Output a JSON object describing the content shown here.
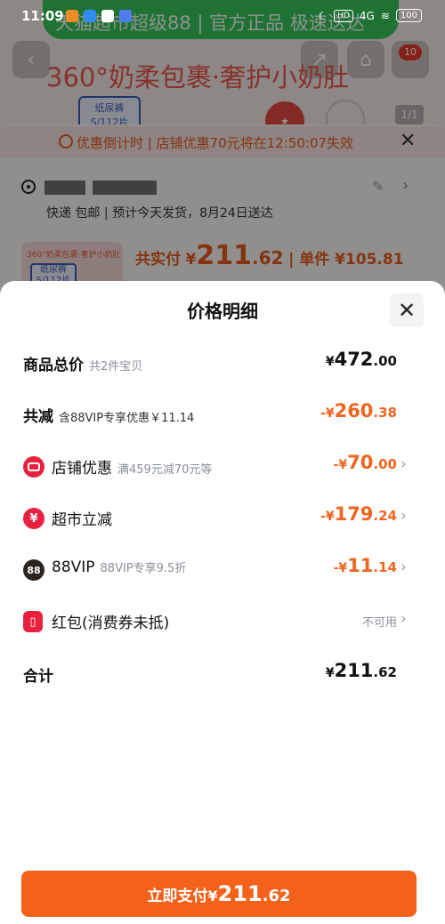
{
  "status_bar": {
    "time": "11:09",
    "network": "4G",
    "hd": "HD",
    "battery": "100"
  },
  "background": {
    "banner": "天猫超市超级88 | 官方正品 极速送达",
    "product_title": "360°奶柔包裹·奢护小奶肚",
    "pack_label": "纸尿裤 S/112片",
    "counter": "1/1",
    "cart_badge": "10",
    "countdown": "优惠倒计时 | 店铺优惠70元将在12:50:07失效",
    "shipping": "快递 包邮 | 预计今天发货，8月24日送达",
    "thumb_caption": "360°奶柔包裹·奢护小奶肚",
    "thumb_pack": "纸尿裤 S/112片",
    "total_label": "共实付",
    "total_currency": "¥",
    "total_int": "211",
    "total_dec": ".62",
    "unit_label": "| 单件 ¥105.81"
  },
  "sheet": {
    "title": "价格明细",
    "rows": {
      "goods_total": {
        "label": "商品总价",
        "note": "共2件宝贝",
        "cur": "¥",
        "int": "472",
        "dec": ".00"
      },
      "reduction": {
        "label": "共减",
        "note": "含88VIP专享优惠￥11.14",
        "cur": "-¥",
        "int": "260",
        "dec": ".38"
      },
      "store_discount": {
        "label": "店铺优惠",
        "note": "满459元减70元等",
        "cur": "-¥",
        "int": "70",
        "dec": ".00"
      },
      "supermarket": {
        "label": "超市立减",
        "cur": "-¥",
        "int": "179",
        "dec": ".24"
      },
      "vip": {
        "label": "88VIP",
        "note": "88VIP专享9.5折",
        "cur": "-¥",
        "int": "11",
        "dec": ".14",
        "icon_text": "88"
      },
      "red_packet": {
        "label": "红包(消费券未抵)",
        "status": "不可用"
      },
      "sum": {
        "label": "合计",
        "cur": "¥",
        "int": "211",
        "dec": ".62"
      }
    },
    "pay_button": {
      "label": "立即支付",
      "cur": "¥",
      "int": "211",
      "dec": ".62"
    }
  },
  "colors": {
    "accent": "#f4611b",
    "discount": "#ee6520",
    "icon_red": "#e8213e"
  }
}
